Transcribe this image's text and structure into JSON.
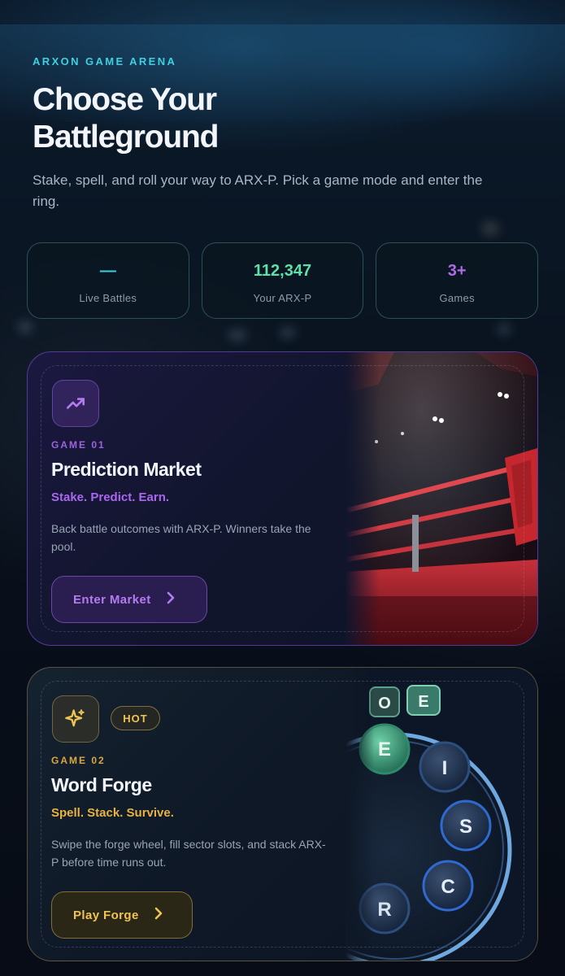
{
  "hero": {
    "eyebrow": "ARXON GAME ARENA",
    "title": "Choose Your Battleground",
    "subtitle": "Stake, spell, and roll your way to ARX-P. Pick a game mode and enter the ring."
  },
  "stats": [
    {
      "value": "—",
      "label": "Live Battles",
      "color": "#3fd0e0"
    },
    {
      "value": "112,347",
      "label": "Your ARX-P",
      "color": "#5ee0a8"
    },
    {
      "value": "3+",
      "label": "Games",
      "color": "#b06ce8"
    }
  ],
  "games": [
    {
      "number": "GAME 01",
      "title": "Prediction Market",
      "tagline": "Stake. Predict. Earn.",
      "description": "Back battle outcomes with ARX-P. Winners take the pool.",
      "cta": "Enter Market",
      "icon": "trending-up-icon",
      "accent": "#a968ee"
    },
    {
      "number": "GAME 02",
      "title": "Word Forge",
      "badge": "HOT",
      "tagline": "Spell. Stack. Survive.",
      "description": "Swipe the forge wheel, fill sector slots, and stack ARX-P before time runs out.",
      "cta": "Play Forge",
      "icon": "sparkles-icon",
      "accent": "#e8b242",
      "wheel_letters": [
        "O",
        "E",
        "E",
        "I",
        "S",
        "C",
        "R"
      ]
    }
  ]
}
